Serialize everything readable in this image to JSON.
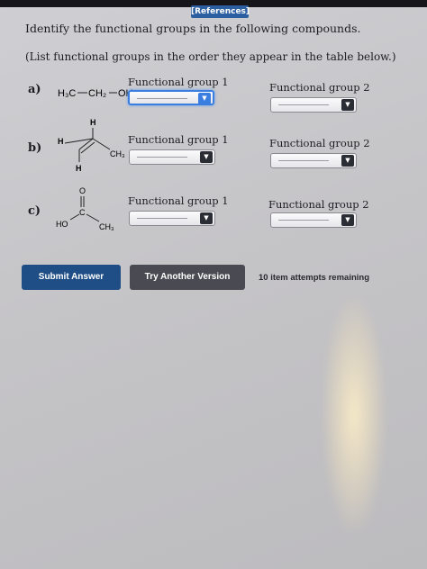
{
  "header": {
    "references_tab": "[References]"
  },
  "question": {
    "title": "Identify the functional groups in the following compounds.",
    "instruction": "(List functional groups in the order they appear in the table below.)"
  },
  "rows": [
    {
      "label": "a)",
      "fg1_label": "Functional group 1",
      "fg2_label": "Functional group 2",
      "molecule": {
        "ch3": "H₃C",
        "ch2": "CH₂",
        "oh": "OH"
      }
    },
    {
      "label": "b)",
      "fg1_label": "Functional group 1",
      "fg2_label": "Functional group 2",
      "molecule": {
        "h_top": "H",
        "h_left": "H",
        "h_bottom": "H",
        "ch3": "CH₃"
      }
    },
    {
      "label": "c)",
      "fg1_label": "Functional group 1",
      "fg2_label": "Functional group 2",
      "molecule": {
        "o": "O",
        "c": "C",
        "ho": "HO",
        "ch3": "CH₃"
      }
    }
  ],
  "buttons": {
    "submit": "Submit Answer",
    "try_another": "Try Another Version"
  },
  "status": {
    "attempts": "10 item attempts remaining"
  },
  "colors": {
    "accent": "#3a7ee0",
    "submit_bg": "#1f4e86",
    "try_bg": "#4a4b52",
    "reference_tab": "#2c5fa1"
  },
  "icons": {
    "dropdown": "chevron-down-icon"
  }
}
